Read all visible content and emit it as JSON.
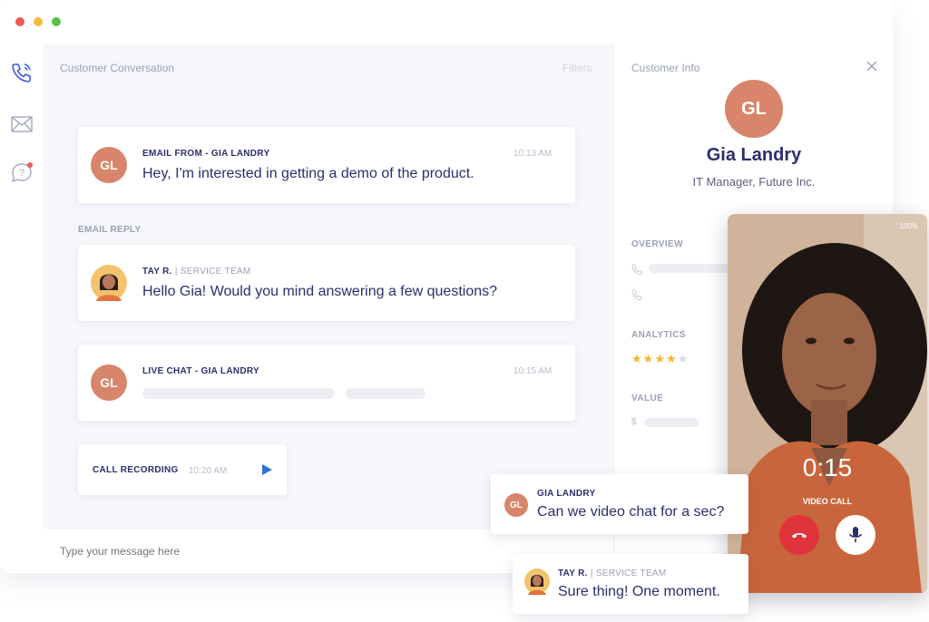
{
  "conversation": {
    "title": "Customer Conversation",
    "filters_label": "Filters",
    "messages": [
      {
        "avatar_initials": "GL",
        "kicker": "EMAIL FROM - GIA LANDRY",
        "text": "Hey, I'm interested in getting a demo of the product.",
        "time": "10:13 AM"
      },
      {
        "section_label": "EMAIL REPLY",
        "sender": "TAY R.",
        "team": "SERVICE TEAM",
        "text": "Hello Gia! Would you mind answering a few questions?"
      },
      {
        "avatar_initials": "GL",
        "kicker": "LIVE CHAT - GIA LANDRY",
        "time": "10:15 AM"
      }
    ],
    "call_recording": {
      "label": "CALL RECORDING",
      "time": "10:20 AM"
    },
    "composer_placeholder": "Type your message here"
  },
  "customer_info": {
    "title": "Customer Info",
    "avatar_initials": "GL",
    "name": "Gia Landry",
    "role": "IT Manager, Future Inc.",
    "sections": {
      "overview": "OVERVIEW",
      "analytics": "ANALYTICS",
      "value": "VALUE"
    },
    "rating": 4,
    "rating_max": 5,
    "value_currency": "$"
  },
  "video_call": {
    "battery": "100%",
    "timer": "0:15",
    "label": "VIDEO CALL"
  },
  "chat_bubbles": [
    {
      "avatar_initials": "GL",
      "sender": "GIA LANDRY",
      "text": "Can we video chat for a sec?"
    },
    {
      "sender": "TAY R.",
      "team": "SERVICE TEAM",
      "text": "Sure thing! One moment."
    }
  ],
  "colors": {
    "accent_avatar": "#d8856b",
    "navy_text": "#2b2f6b",
    "play_blue": "#2f6fe0",
    "end_call_red": "#e0343c",
    "star_gold": "#f2b62f"
  }
}
